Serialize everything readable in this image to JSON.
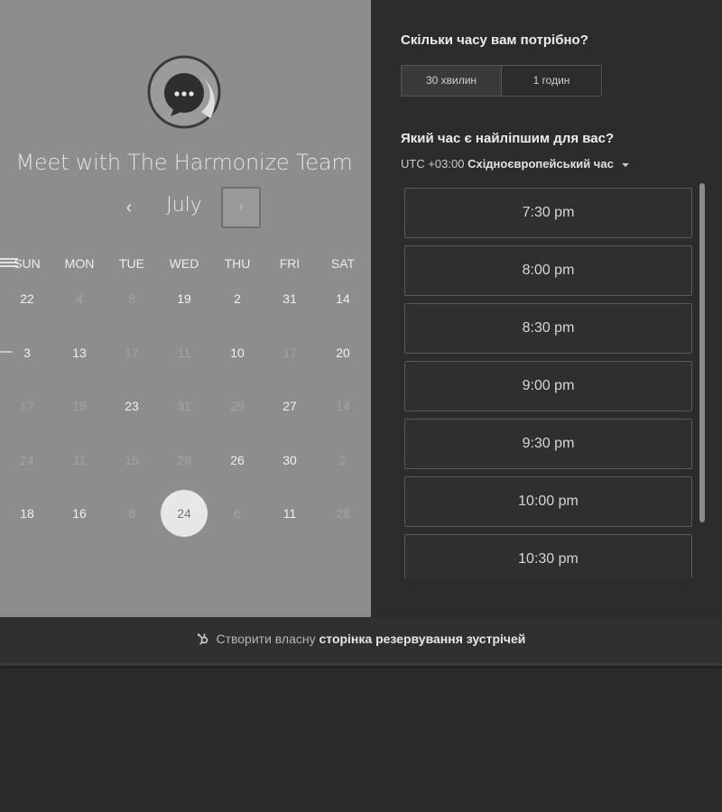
{
  "left": {
    "title": "Meet with The Harmonize Team",
    "month": "July",
    "prev_glyph": "‹",
    "next_glyph": "›",
    "weekdays": [
      "SUN",
      "MON",
      "TUE",
      "WED",
      "THU",
      "FRI",
      "SAT"
    ],
    "weeks": [
      [
        {
          "d": "22",
          "on": true
        },
        {
          "d": "4",
          "on": false
        },
        {
          "d": "8",
          "on": false
        },
        {
          "d": "19",
          "on": true
        },
        {
          "d": "2",
          "on": true
        },
        {
          "d": "31",
          "on": true
        },
        {
          "d": "14",
          "on": true
        }
      ],
      [
        {
          "d": "3",
          "on": true
        },
        {
          "d": "13",
          "on": true
        },
        {
          "d": "17",
          "on": false
        },
        {
          "d": "11",
          "on": false
        },
        {
          "d": "10",
          "on": true
        },
        {
          "d": "17",
          "on": false
        },
        {
          "d": "20",
          "on": true
        }
      ],
      [
        {
          "d": "17",
          "on": false
        },
        {
          "d": "15",
          "on": false
        },
        {
          "d": "23",
          "on": true
        },
        {
          "d": "31",
          "on": false
        },
        {
          "d": "29",
          "on": false
        },
        {
          "d": "27",
          "on": true
        },
        {
          "d": "14",
          "on": false
        }
      ],
      [
        {
          "d": "24",
          "on": false
        },
        {
          "d": "11",
          "on": false
        },
        {
          "d": "15",
          "on": false
        },
        {
          "d": "29",
          "on": false
        },
        {
          "d": "26",
          "on": true
        },
        {
          "d": "30",
          "on": true
        },
        {
          "d": "2",
          "on": false
        }
      ],
      [
        {
          "d": "18",
          "on": true
        },
        {
          "d": "16",
          "on": true
        },
        {
          "d": "8",
          "on": false
        },
        {
          "d": "24",
          "on": true,
          "selected": true
        },
        {
          "d": "6",
          "on": false
        },
        {
          "d": "11",
          "on": true
        },
        {
          "d": "28",
          "on": false
        }
      ]
    ]
  },
  "right": {
    "duration_heading": "Скільки часу вам потрібно?",
    "durations": [
      "30 хвилин",
      "1 годин"
    ],
    "active_duration": "30 хвилин",
    "time_heading": "Який час є найліпшим для вас?",
    "tz_offset": "UTC +03:00",
    "tz_name": "Східноєвропейський час",
    "slots": [
      "7:30 pm",
      "8:00 pm",
      "8:30 pm",
      "9:00 pm",
      "9:30 pm",
      "10:00 pm",
      "10:30 pm"
    ]
  },
  "footer": {
    "prefix": "Створити власну",
    "link": "сторінка резервування зустрічей"
  },
  "colors": {
    "left_bg": "#8d8d8d",
    "right_bg": "#2c2c2c",
    "selected_day": "#e7e7e7"
  },
  "icons": {
    "logo": "chat-bubble-icon",
    "footer": "hubspot-sprocket-icon"
  }
}
